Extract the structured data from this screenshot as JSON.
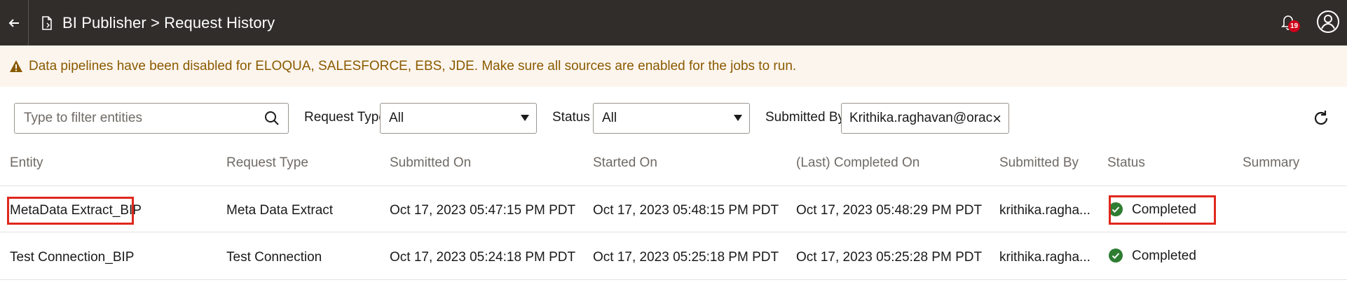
{
  "header": {
    "title": "BI Publisher > Request History",
    "notification_count": "19"
  },
  "banner": {
    "message": "Data pipelines have been disabled for ELOQUA, SALESFORCE, EBS, JDE. Make sure all sources are enabled for the jobs to run."
  },
  "filters": {
    "search_placeholder": "Type to filter entities",
    "request_type_label": "Request Type",
    "request_type_value": "All",
    "status_label": "Status",
    "status_value": "All",
    "submitted_by_label": "Submitted By",
    "submitted_by_value": "Krithika.raghavan@orac"
  },
  "table": {
    "columns": [
      "Entity",
      "Request Type",
      "Submitted On",
      "Started On",
      "(Last) Completed On",
      "Submitted By",
      "Status",
      "Summary"
    ],
    "rows": [
      {
        "entity": "MetaData Extract_BIP",
        "request_type": "Meta Data Extract",
        "submitted_on": "Oct 17, 2023 05:47:15 PM PDT",
        "started_on": "Oct 17, 2023 05:48:15 PM PDT",
        "completed_on": "Oct 17, 2023 05:48:29 PM PDT",
        "submitted_by": "krithika.ragha...",
        "status": "Completed",
        "summary": ""
      },
      {
        "entity": "Test Connection_BIP",
        "request_type": "Test Connection",
        "submitted_on": "Oct 17, 2023 05:24:18 PM PDT",
        "started_on": "Oct 17, 2023 05:25:18 PM PDT",
        "completed_on": "Oct 17, 2023 05:25:28 PM PDT",
        "submitted_by": "krithika.ragha...",
        "status": "Completed",
        "summary": ""
      }
    ]
  },
  "colors": {
    "header_bg": "#312d2a",
    "banner_bg": "#fcf5ee",
    "warning_text": "#8a5a00",
    "status_success": "#2e7d32",
    "highlight": "#e0281d"
  }
}
